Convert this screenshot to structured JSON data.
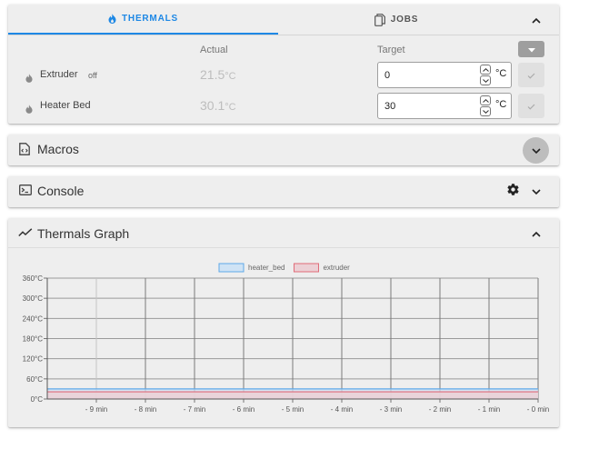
{
  "thermals": {
    "tab_thermals": "THERMALS",
    "tab_jobs": "JOBS",
    "col_actual": "Actual",
    "col_target": "Target",
    "heaters": [
      {
        "name": "Extruder",
        "state": "off",
        "actual": "21.5",
        "actual_unit": "°C",
        "target": "0",
        "target_unit": "°C"
      },
      {
        "name": "Heater Bed",
        "state": "",
        "actual": "30.1",
        "actual_unit": "°C",
        "target": "30",
        "target_unit": "°C"
      }
    ]
  },
  "macros": {
    "title": "Macros"
  },
  "console": {
    "title": "Console"
  },
  "graph": {
    "title": "Thermals Graph"
  },
  "chart_data": {
    "type": "line",
    "title": "",
    "xlabel": "",
    "ylabel": "",
    "x_ticks": [
      "- 9 min",
      "- 8 min",
      "- 7 min",
      "- 6 min",
      "- 5 min",
      "- 4 min",
      "- 3 min",
      "- 2 min",
      "- 1 min",
      "- 0 min"
    ],
    "x_values": [
      -10,
      -9,
      -8,
      -7,
      -6,
      -5,
      -4,
      -3,
      -2,
      -1,
      0
    ],
    "y_ticks": [
      "0°C",
      "60°C",
      "120°C",
      "180°C",
      "240°C",
      "300°C",
      "360°C"
    ],
    "ylim": [
      0,
      360
    ],
    "xlim": [
      -10,
      0
    ],
    "grid": true,
    "legend_position": "top-center",
    "series": [
      {
        "name": "heater_bed",
        "color": "#5fa8e8",
        "fill": "#cfe3f5",
        "values": [
          30.1,
          30.1,
          30.1,
          30.1,
          30.1,
          30.1,
          30.1,
          30.1,
          30.1,
          30.1,
          30.1
        ]
      },
      {
        "name": "extruder",
        "color": "#e06b78",
        "fill": "#ecd0d5",
        "values": [
          21.5,
          21.5,
          21.5,
          21.5,
          21.5,
          21.5,
          21.5,
          21.5,
          21.5,
          21.5,
          21.5
        ]
      }
    ]
  },
  "colors": {
    "accent": "#1e88e5",
    "card": "#eeeeee"
  }
}
